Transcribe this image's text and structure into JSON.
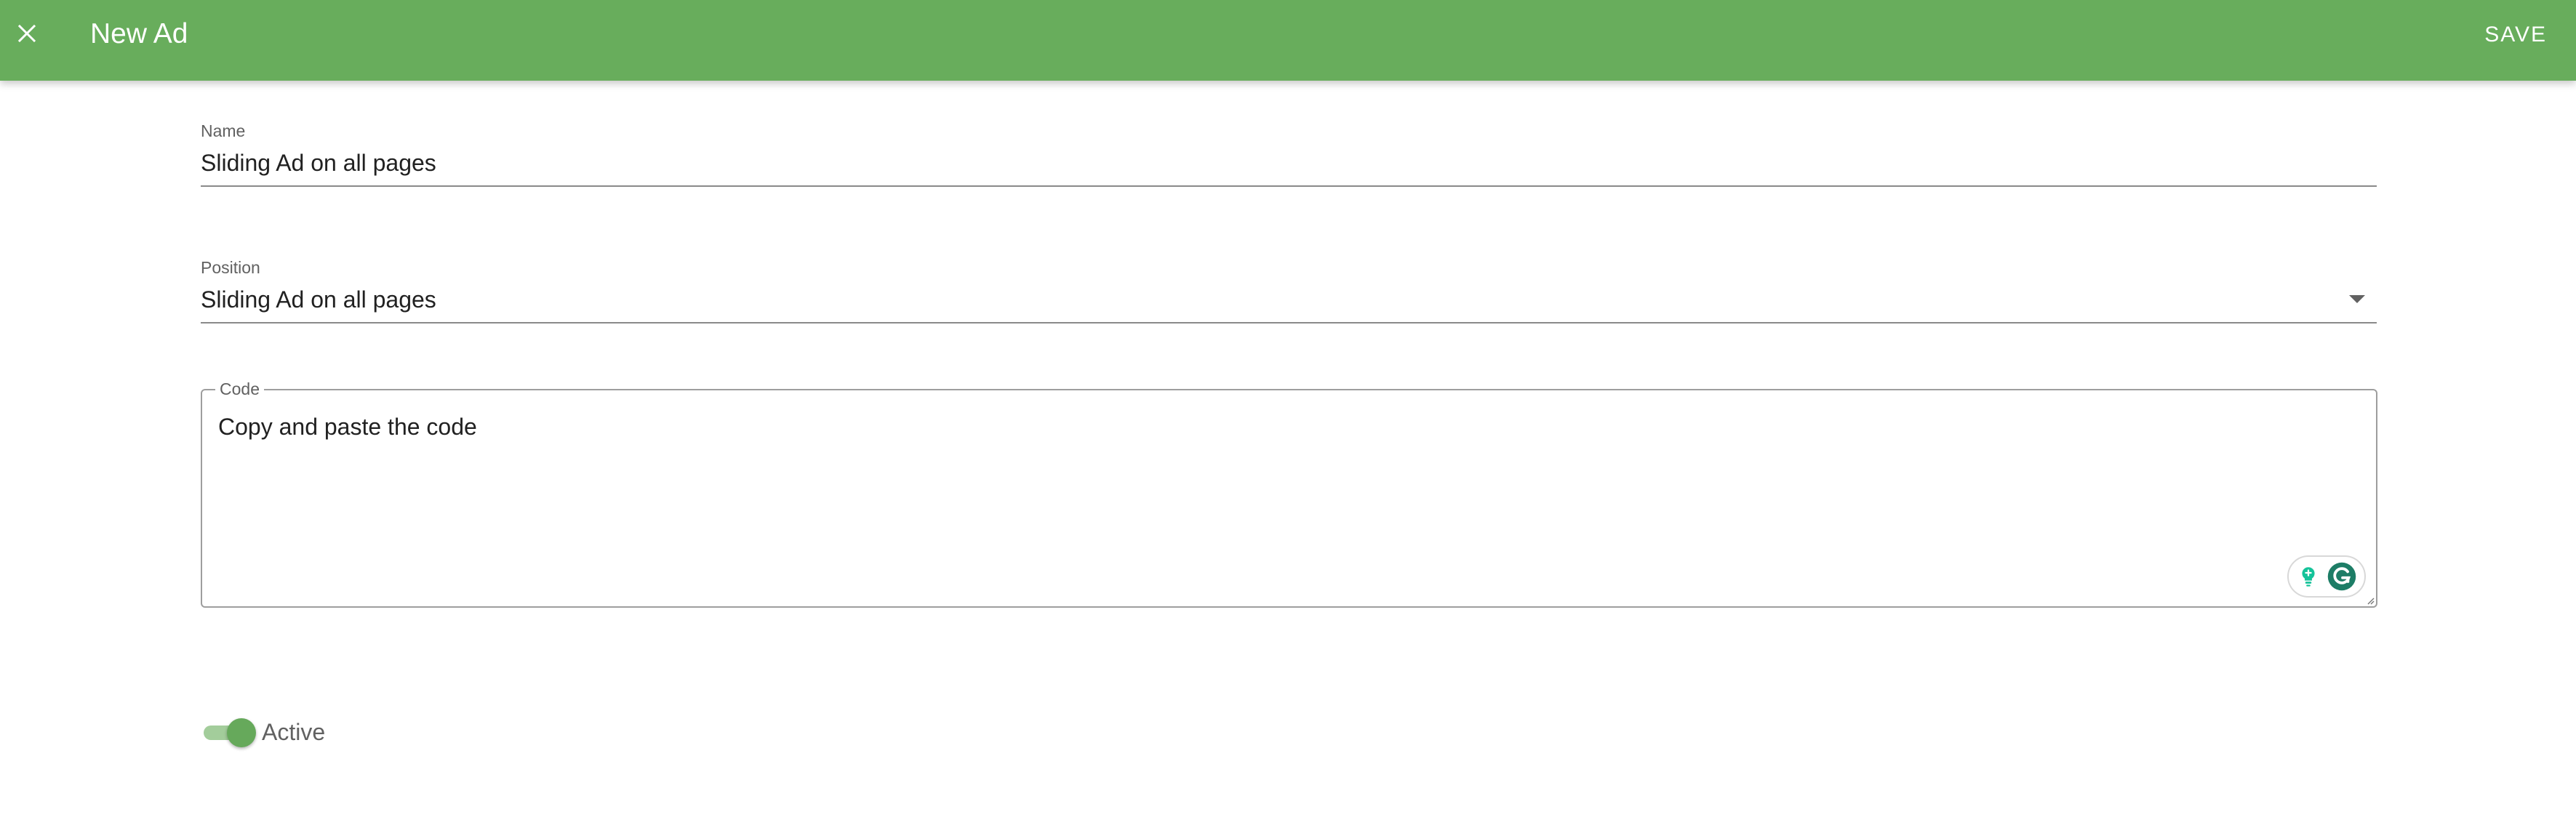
{
  "app_bar": {
    "title": "New Ad",
    "save_label": "SAVE",
    "close_icon": "close-icon",
    "background_color": "#68ad5c"
  },
  "form": {
    "name": {
      "label": "Name",
      "value": "Sliding Ad on all pages"
    },
    "position": {
      "label": "Position",
      "value": "Sliding Ad on all pages",
      "icon": "chevron-down-icon"
    },
    "code": {
      "label": "Code",
      "value": "Copy and paste the code"
    },
    "active": {
      "label": "Active",
      "checked": true
    }
  },
  "grammarly_widget": {
    "icons": [
      "lightbulb-icon",
      "grammarly-icon"
    ],
    "accent_color": "#15c39a"
  }
}
